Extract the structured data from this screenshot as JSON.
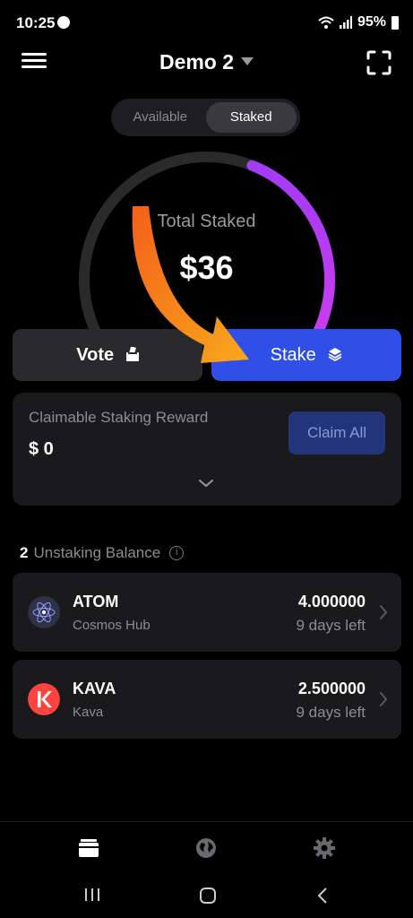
{
  "status": {
    "time": "10:25",
    "battery": "95%"
  },
  "header": {
    "wallet_name": "Demo 2"
  },
  "segment": {
    "tabs": [
      "Available",
      "Staked"
    ],
    "active": 1
  },
  "gauge": {
    "label": "Total Staked",
    "value": "$36",
    "fill_fraction": 0.42
  },
  "actions": {
    "vote_label": "Vote",
    "stake_label": "Stake"
  },
  "reward": {
    "title": "Claimable Staking Reward",
    "value": "$ 0",
    "claim_label": "Claim All"
  },
  "unstaking": {
    "count": "2",
    "title": "Unstaking Balance",
    "items": [
      {
        "symbol": "ATOM",
        "network": "Cosmos Hub",
        "amount": "4.000000",
        "days_left": "9 days left",
        "icon": "atom-icon"
      },
      {
        "symbol": "KAVA",
        "network": "Kava",
        "amount": "2.500000",
        "days_left": "9 days left",
        "icon": "kava-icon"
      }
    ]
  },
  "colors": {
    "accent_blue": "#2f4fe6",
    "gauge_purple": "#c23bf5",
    "arrow_orange": "#f59a1a",
    "kava_red": "#ff433e"
  }
}
